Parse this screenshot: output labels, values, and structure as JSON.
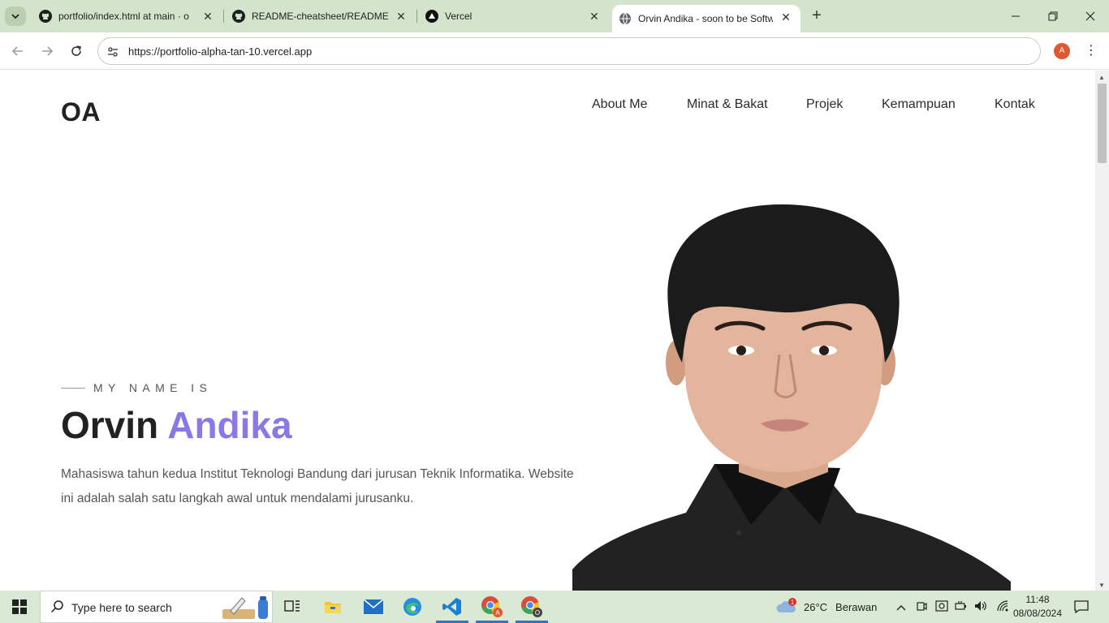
{
  "browser": {
    "tabs": [
      {
        "title": "portfolio/index.html at main · o",
        "favicon": "github-icon",
        "active": false
      },
      {
        "title": "README-cheatsheet/README.m",
        "favicon": "github-icon",
        "active": false
      },
      {
        "title": "Vercel",
        "favicon": "vercel-icon",
        "active": false
      },
      {
        "title": "Orvin Andika - soon to be Softw",
        "favicon": "globe-icon",
        "active": true
      }
    ],
    "url": "https://portfolio-alpha-tan-10.vercel.app",
    "profile_initial": "A",
    "frame_color": "#d3e3cc"
  },
  "site": {
    "logo": "OA",
    "nav": [
      "About Me",
      "Minat & Bakat",
      "Projek",
      "Kemampuan",
      "Kontak"
    ],
    "eyebrow": "MY NAME IS",
    "first_name": "Orvin",
    "last_name": "Andika",
    "accent_color": "#8b78e6",
    "description": "Mahasiswa tahun kedua Institut Teknologi Bandung dari jurusan Teknik Informatika. Website ini adalah salah satu langkah awal untuk mendalami jurusanku."
  },
  "taskbar": {
    "search_placeholder": "Type here to search",
    "apps": [
      "task-view-icon",
      "file-explorer-icon",
      "mail-icon",
      "edge-icon",
      "vscode-icon",
      "chrome-icon",
      "chrome-icon"
    ],
    "weather_temp": "26°C",
    "weather_text": "Berawan",
    "weather_badge": "1",
    "time": "11:48",
    "date": "08/08/2024"
  }
}
